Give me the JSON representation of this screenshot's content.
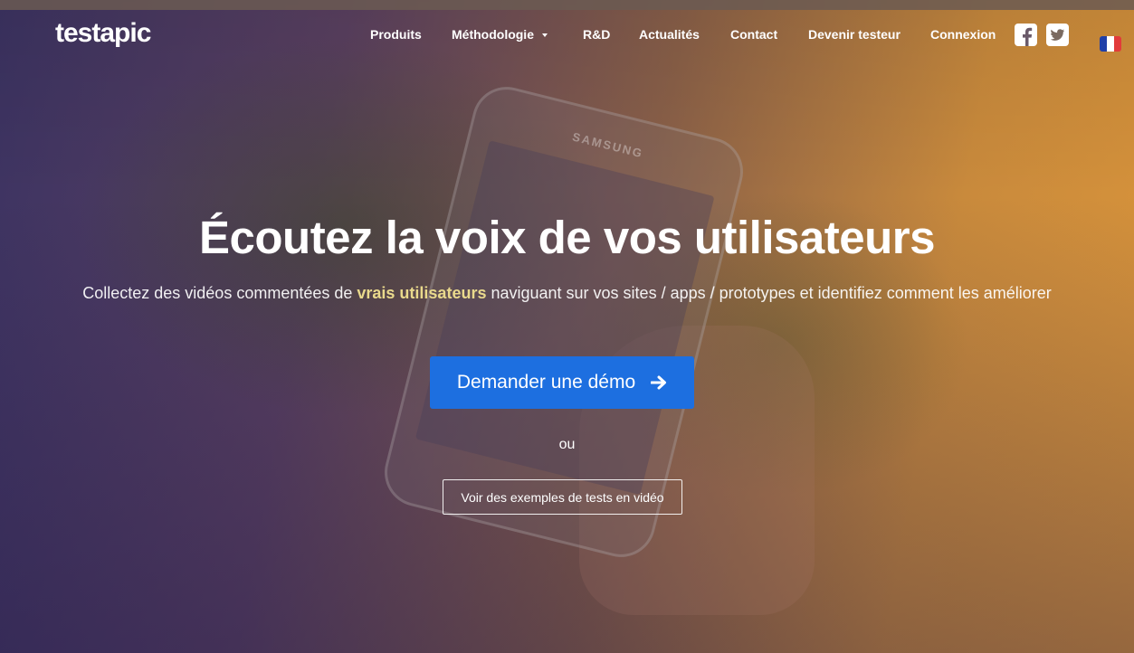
{
  "brand": {
    "logo_text": "testapic"
  },
  "nav": {
    "items": [
      {
        "label": "Produits"
      },
      {
        "label": "Méthodologie",
        "has_dropdown": true
      },
      {
        "label": "R&D"
      },
      {
        "label": "Actualités"
      },
      {
        "label": "Contact"
      },
      {
        "label": "Devenir testeur"
      },
      {
        "label": "Connexion"
      }
    ],
    "social": [
      {
        "icon": "facebook-icon"
      },
      {
        "icon": "twitter-icon"
      }
    ],
    "language_flag": {
      "icon": "french-flag-icon",
      "colors": [
        "#1f3fa8",
        "#ffffff",
        "#e23a3a"
      ]
    }
  },
  "background": {
    "phone_brand": "SAMSUNG"
  },
  "hero": {
    "headline": "Écoutez la voix de vos utilisateurs",
    "subhead_before": "Collectez des vidéos commentées de ",
    "subhead_highlight": "vrais utilisateurs",
    "subhead_after": " naviguant sur vos sites / apps / prototypes et identifiez comment les améliorer",
    "cta_label": "Demander une démo",
    "or_text": "ou",
    "secondary_label": "Voir des exemples de tests en vidéo"
  },
  "colors": {
    "cta_blue": "#1d6fe0",
    "highlight": "#e9d98c"
  }
}
